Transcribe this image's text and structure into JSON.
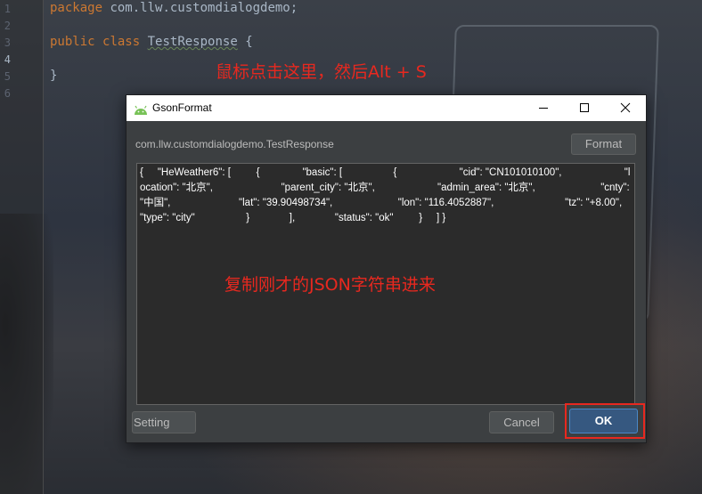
{
  "editor": {
    "line_numbers": [
      "1",
      "2",
      "3",
      "4",
      "5",
      "6"
    ],
    "line1": {
      "keyword": "package",
      "rest": " com.llw.customdialogdemo;"
    },
    "line3": {
      "kw1": "public",
      "kw2": "class",
      "class_name": "TestResponse",
      "brace": " {"
    },
    "line5": "}"
  },
  "annotations": {
    "top": "鼠标点击这里，然后Alt + S",
    "middle": "复制刚才的JSON字符串进来"
  },
  "dialog": {
    "title": "GsonFormat",
    "class_path": "com.llw.customdialogdemo.TestResponse",
    "format_label": "Format",
    "json_text": "{     \"HeWeather6\": [         {               \"basic\": [                  {                      \"cid\": \"CN101010100\",                      \"location\": \"北京\",                        \"parent_city\": \"北京\",                      \"admin_area\": \"北京\",                       \"cnty\": \"中国\",                        \"lat\": \"39.90498734\",                       \"lon\": \"116.4052887\",                         \"tz\": \"+8.00\",                      \"type\": \"city\"                  }              ],              \"status\": \"ok\"         }     ] }",
    "setting_label": "Setting",
    "cancel_label": "Cancel",
    "ok_label": "OK"
  },
  "colors": {
    "keyword": "#cc7832",
    "annotation_red": "#e8281f",
    "ok_button": "#365880",
    "dialog_bg": "#3c3f41"
  }
}
